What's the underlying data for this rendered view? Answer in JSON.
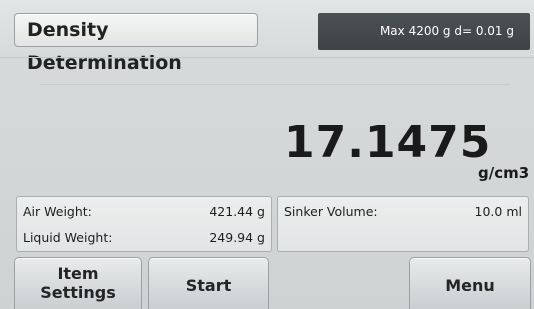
{
  "header": {
    "title": "Density Determination",
    "capacity": "Max 4200 g  d= 0.01 g"
  },
  "reading": {
    "value": "17.1475",
    "unit": "g/cm3"
  },
  "info_left": {
    "air_weight_label": "Air Weight:",
    "air_weight_value": "421.44 g",
    "liquid_weight_label": "Liquid Weight:",
    "liquid_weight_value": "249.94 g"
  },
  "info_right": {
    "sinker_volume_label": "Sinker Volume:",
    "sinker_volume_value": "10.0 ml"
  },
  "buttons": {
    "item_settings_line1": "Item",
    "item_settings_line2": "Settings",
    "start": "Start",
    "menu": "Menu"
  }
}
